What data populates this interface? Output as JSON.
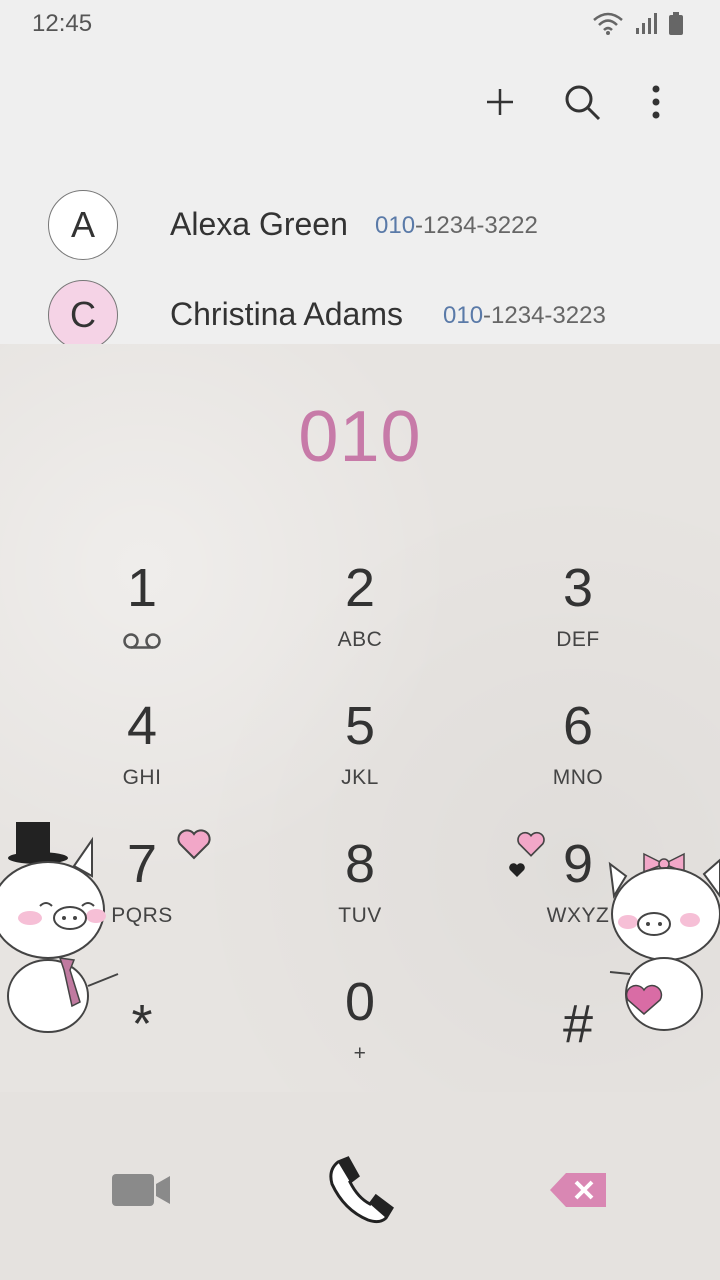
{
  "status": {
    "time": "12:45",
    "icons": [
      "wifi-icon",
      "signal-icon",
      "battery-icon"
    ]
  },
  "toolbar": {
    "actions": [
      "add-icon",
      "search-icon",
      "more-options-icon"
    ]
  },
  "contacts": [
    {
      "initial": "A",
      "name": "Alexa Green",
      "number_highlight": "010",
      "number_rest": "-1234-3222",
      "avatar_color": "#ffffff"
    },
    {
      "initial": "C",
      "name": "Christina Adams",
      "number_highlight": "010",
      "number_rest": "-1234-3223",
      "avatar_color": "#f5d3e6"
    }
  ],
  "dialer": {
    "typed_number": "010",
    "keys": [
      {
        "digit": "1",
        "letters": ""
      },
      {
        "digit": "2",
        "letters": "ABC"
      },
      {
        "digit": "3",
        "letters": "DEF"
      },
      {
        "digit": "4",
        "letters": "GHI"
      },
      {
        "digit": "5",
        "letters": "JKL"
      },
      {
        "digit": "6",
        "letters": "MNO"
      },
      {
        "digit": "7",
        "letters": "PQRS"
      },
      {
        "digit": "8",
        "letters": "TUV"
      },
      {
        "digit": "9",
        "letters": "WXYZ"
      },
      {
        "digit": "*",
        "letters": ""
      },
      {
        "digit": "0",
        "letters": "+"
      },
      {
        "digit": "#",
        "letters": ""
      }
    ]
  },
  "bottom": {
    "buttons": [
      "video-call-icon",
      "call-icon",
      "backspace-icon"
    ]
  },
  "colors": {
    "accent": "#c77aa8",
    "number_highlight": "#5a7aa8",
    "backspace": "#d987b3"
  }
}
